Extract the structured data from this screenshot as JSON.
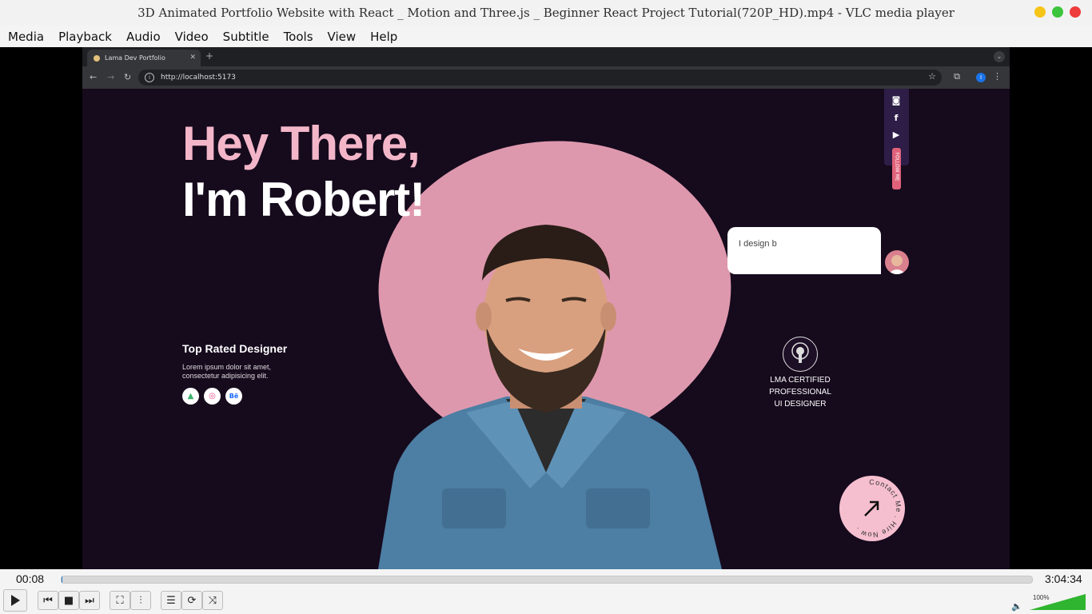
{
  "window": {
    "title": "3D Animated Portfolio Website with React _ Motion and Three.js _ Beginner React Project Tutorial(720P_HD).mp4 - VLC media player",
    "buttons": [
      "minimize",
      "maximize",
      "close"
    ],
    "button_colors": {
      "minimize": "#f5c518",
      "maximize": "#3cc43c",
      "close": "#ee3b3b"
    }
  },
  "menu": {
    "items": [
      {
        "label": "Media",
        "key": "M"
      },
      {
        "label": "Playback",
        "key": "P"
      },
      {
        "label": "Audio",
        "key": "A"
      },
      {
        "label": "Video",
        "key": "V"
      },
      {
        "label": "Subtitle",
        "key": "S"
      },
      {
        "label": "Tools",
        "key": "T"
      },
      {
        "label": "View",
        "key": "V"
      },
      {
        "label": "Help",
        "key": "H"
      }
    ]
  },
  "browser": {
    "tab_title": "Lama Dev Portfolio",
    "url": "http://localhost:5173",
    "profile_initial": "I"
  },
  "portfolio": {
    "heading_line1": "Hey There,",
    "heading_line2": "I'm Robert!",
    "follow_label": "FOLLOW ME",
    "social_icons": [
      "instagram-icon",
      "facebook-icon",
      "youtube-icon"
    ],
    "bubble_text": "I design b",
    "top_rated_title": "Top Rated Designer",
    "top_rated_desc": "Lorem ipsum dolor sit amet, consectetur adipisicing elit.",
    "app_icons": [
      "android-icon",
      "dribbble-icon",
      "behance-icon"
    ],
    "cert_line1": "LMA CERTIFIED",
    "cert_line2": "PROFESSIONAL",
    "cert_line3": "UI DESIGNER",
    "contact_text": "Contact Me . Hire Now .",
    "colors": {
      "pink": "#f3b6c9",
      "blob": "#de98ad",
      "bg": "#160a1d"
    }
  },
  "player": {
    "elapsed": "00:08",
    "total": "3:04:34",
    "progress_fraction": 0.0007,
    "volume_label": "100%",
    "volume_level": 1.0,
    "accent": "#1976d2"
  }
}
